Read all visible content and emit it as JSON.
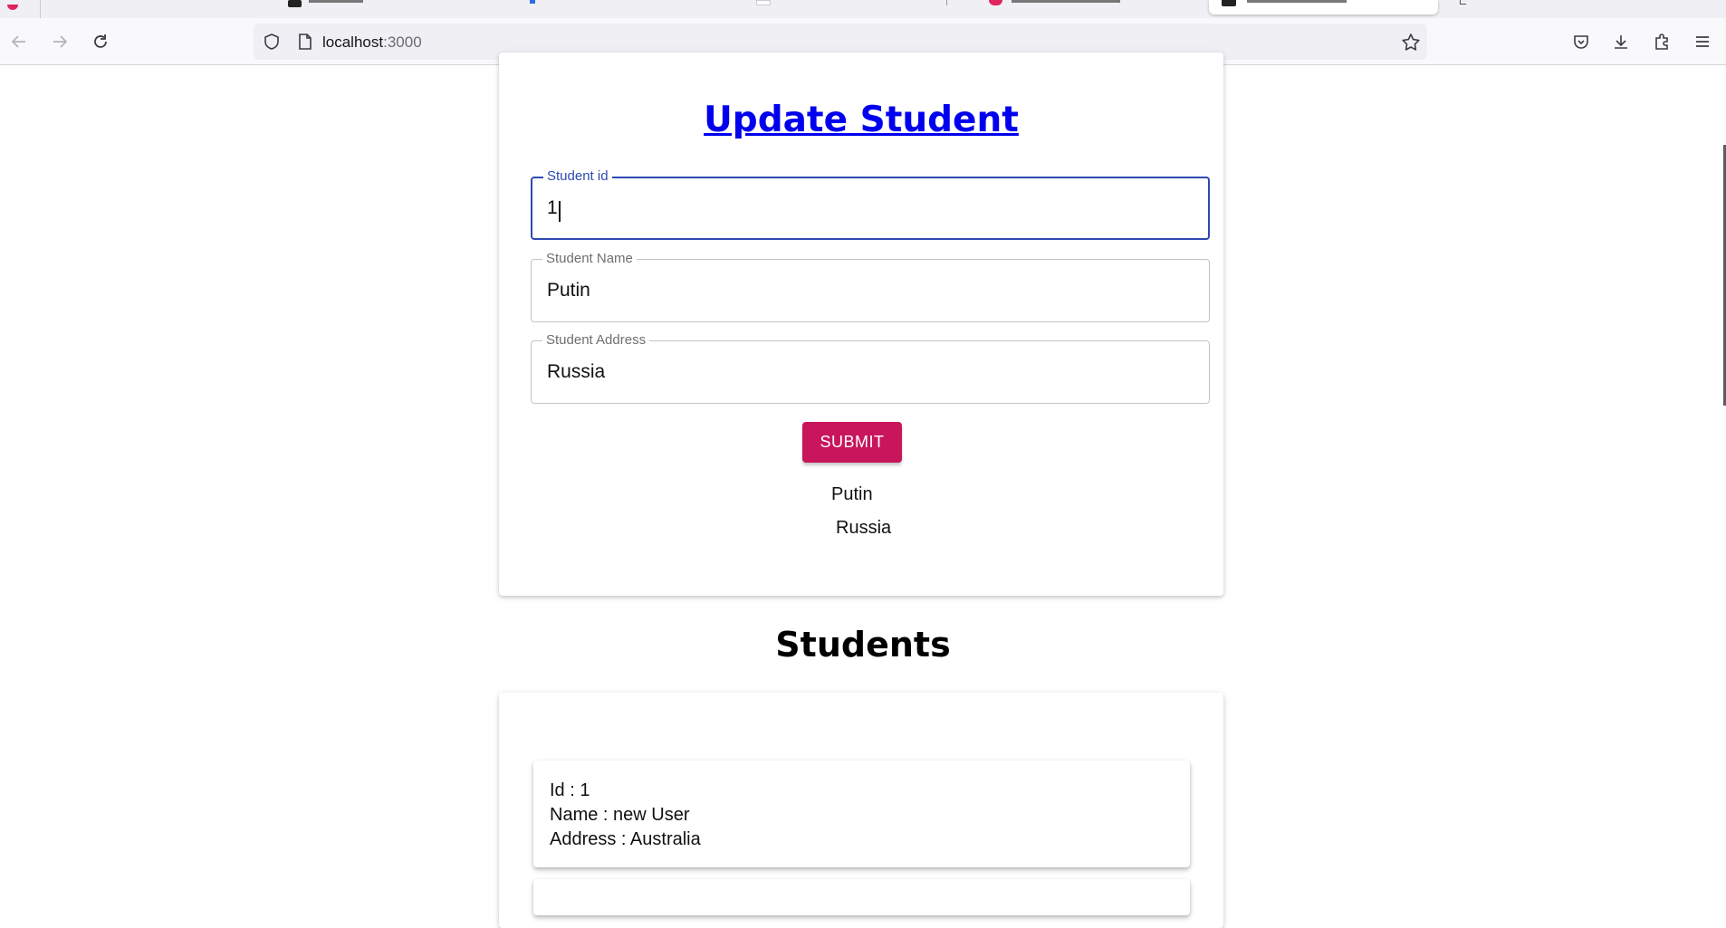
{
  "browser": {
    "url_host": "localhost",
    "url_port": ":3000"
  },
  "form": {
    "title": "Update Student",
    "fields": [
      {
        "label": "Student id",
        "value": "1"
      },
      {
        "label": "Student Name",
        "value": "Putin"
      },
      {
        "label": "Student Address",
        "value": "Russia"
      }
    ],
    "submit_label": "SUBMIT",
    "echo_name": "Putin",
    "echo_address": "Russia"
  },
  "students": {
    "heading": "Students",
    "items": [
      {
        "id_line": "Id : 1",
        "name_line": "Name : new User",
        "address_line": "Address : Australia"
      }
    ]
  },
  "colors": {
    "accent_button": "#c8155c",
    "focus_border": "#2e49b0",
    "link": "#0000ee"
  }
}
